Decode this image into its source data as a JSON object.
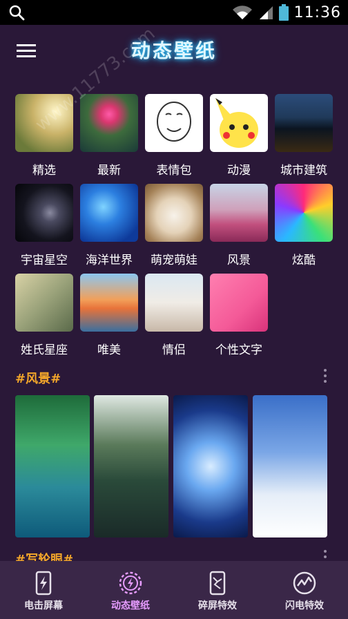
{
  "status": {
    "time": "11:36",
    "icons": [
      "search-icon",
      "wifi-icon",
      "signal-icon",
      "battery-icon"
    ]
  },
  "header": {
    "title": "动态壁纸",
    "menu_icon": "menu-icon"
  },
  "categories": [
    {
      "label": "精选"
    },
    {
      "label": "最新"
    },
    {
      "label": "表情包"
    },
    {
      "label": "动漫"
    },
    {
      "label": "城市建筑"
    },
    {
      "label": "宇宙星空"
    },
    {
      "label": "海洋世界"
    },
    {
      "label": "萌宠萌娃"
    },
    {
      "label": "风景"
    },
    {
      "label": "炫酷"
    },
    {
      "label": "姓氏星座"
    },
    {
      "label": "唯美"
    },
    {
      "label": "情侣"
    },
    {
      "label": "个性文字"
    }
  ],
  "sections": [
    {
      "title": "#风景#"
    },
    {
      "title": "#写轮眼#"
    }
  ],
  "bottom_nav": [
    {
      "label": "电击屏幕",
      "icon": "phone-bolt-icon",
      "active": false
    },
    {
      "label": "动态壁纸",
      "icon": "bolt-ring-icon",
      "active": true
    },
    {
      "label": "碎屏特效",
      "icon": "broken-phone-icon",
      "active": false
    },
    {
      "label": "闪电特效",
      "icon": "lightning-circle-icon",
      "active": false
    }
  ],
  "watermark": "www.11773.com",
  "colors": {
    "background": "#2a1838",
    "section_title": "#f4a72a",
    "active_nav": "#e79cff",
    "title_glow": "#3ad2ff"
  }
}
